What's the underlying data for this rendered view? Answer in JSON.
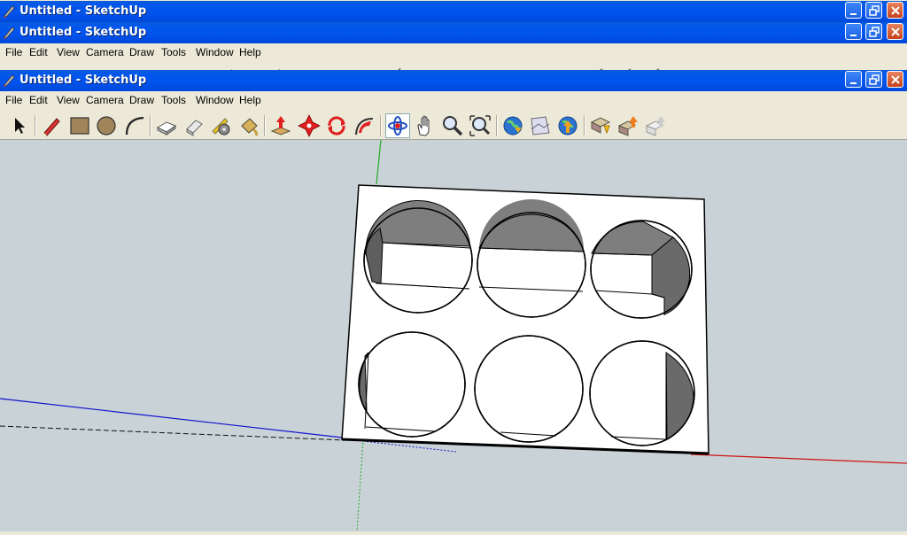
{
  "windows": [
    {
      "title": "Untitled - SketchUp"
    },
    {
      "title": "Untitled - SketchUp"
    },
    {
      "title": "Untitled - SketchUp"
    }
  ],
  "menu": {
    "file": "File",
    "edit": "Edit",
    "view": "View",
    "camera": "Camera",
    "draw": "Draw",
    "tools": "Tools",
    "window": "Window",
    "help": "Help"
  },
  "toolbar_icons": [
    "select-icon",
    "pencil-line-icon",
    "rectangle-icon",
    "circle-icon",
    "arc-icon",
    "make-component-icon",
    "eraser-icon",
    "tape-measure-icon",
    "paint-bucket-icon",
    "push-pull-icon",
    "move-icon",
    "rotate-icon",
    "follow-me-icon",
    "orbit-icon",
    "pan-icon",
    "zoom-icon",
    "zoom-extents-icon",
    "get-current-view-icon",
    "toggle-terrain-icon",
    "place-model-icon",
    "get-models-icon",
    "share-model-icon",
    "share-component-icon"
  ],
  "colors": {
    "titlebar": "#0153ee",
    "chrome": "#ece9d8",
    "viewport_bg": "#c9d3d7",
    "axis_red": "#cc1111",
    "axis_green": "#22aa22",
    "axis_blue": "#1111cc",
    "face_white": "#ffffff",
    "face_dark": "#6e6e6e",
    "face_mid": "#8a8a8a"
  }
}
